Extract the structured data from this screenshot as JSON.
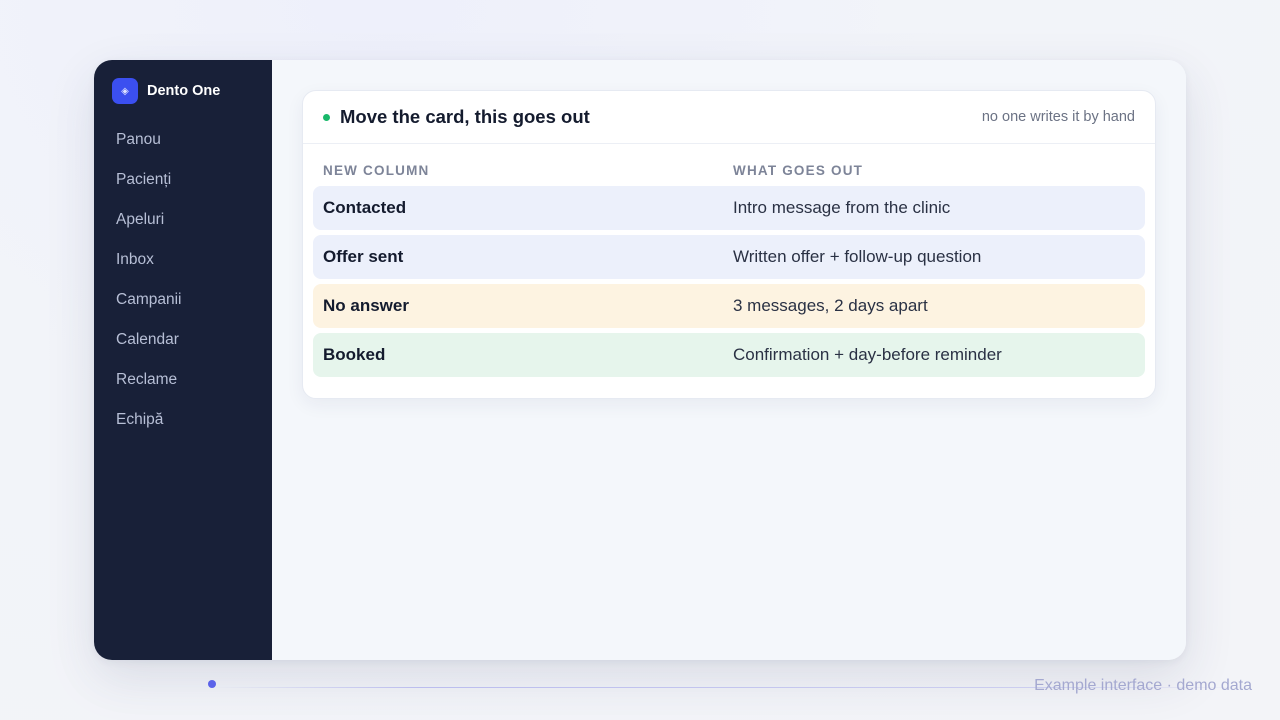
{
  "brand": {
    "name": "Dento One",
    "icon": "logo-icon"
  },
  "sidebar": {
    "items": [
      {
        "label": "Panou"
      },
      {
        "label": "Pacienți"
      },
      {
        "label": "Apeluri"
      },
      {
        "label": "Inbox"
      },
      {
        "label": "Campanii"
      },
      {
        "label": "Calendar"
      },
      {
        "label": "Reclame"
      },
      {
        "label": "Echipă"
      }
    ]
  },
  "card": {
    "title": "Move the card, this goes out",
    "note": "no one writes it by hand",
    "status_color": "#18b86a",
    "columns": [
      "NEW COLUMN",
      "WHAT GOES OUT"
    ],
    "rows": [
      {
        "name": "Contacted",
        "message": "Intro message from the clinic",
        "color": "#ecf0fb"
      },
      {
        "name": "Offer sent",
        "message": "Written offer + follow-up question",
        "color": "#ecf0fb"
      },
      {
        "name": "No answer",
        "message": "3 messages, 2 days apart",
        "color": "#fdf3e1"
      },
      {
        "name": "Booked",
        "message": "Confirmation + day-before reminder",
        "color": "#e6f5ec"
      }
    ]
  },
  "footer": {
    "caption": "Example interface · demo data",
    "accent": "#5b63e9"
  }
}
